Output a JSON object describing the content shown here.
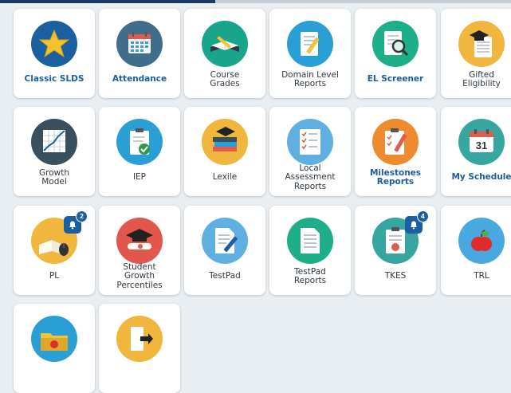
{
  "apps": [
    {
      "label": "Classic SLDS",
      "icon": "star-icon",
      "style": "link",
      "bg": "#1a5fa0"
    },
    {
      "label": "Attendance",
      "icon": "calendar-icon",
      "style": "link",
      "bg": "#3f6d8a"
    },
    {
      "label": "Course\nGrades",
      "icon": "book-pencil-icon",
      "style": "plain",
      "bg": "#18a58c"
    },
    {
      "label": "Domain Level\nReports",
      "icon": "report-pencil-icon",
      "style": "plain",
      "bg": "#2a9fd6"
    },
    {
      "label": "EL Screener",
      "icon": "magnifier-document-icon",
      "style": "link",
      "bg": "#1fae8a"
    },
    {
      "label": "Gifted\nEligibility",
      "icon": "graduation-notebook-icon",
      "style": "plain",
      "bg": "#f0b63e"
    },
    {
      "label": "Growth\nModel",
      "icon": "growth-chart-icon",
      "style": "plain",
      "bg": "#3a4f5e"
    },
    {
      "label": "IEP",
      "icon": "clipboard-check-icon",
      "style": "plain",
      "bg": "#2a9fd6"
    },
    {
      "label": "Lexile",
      "icon": "books-cap-icon",
      "style": "plain",
      "bg": "#f0b63e"
    },
    {
      "label": "Local\nAssessment\nReports",
      "icon": "checklist-icon",
      "style": "plain",
      "bg": "#5fb0e0"
    },
    {
      "label": "Milestones\nReports",
      "icon": "clipboard-pencil-icon",
      "style": "link",
      "bg": "#f08a2e"
    },
    {
      "label": "My Schedule",
      "icon": "calendar-31-icon",
      "style": "link",
      "bg": "#37a6a0",
      "day": "31"
    },
    {
      "label": "PL",
      "icon": "book-mouse-icon",
      "style": "plain",
      "bg": "#f0b63e",
      "badge": "2"
    },
    {
      "label": "Student\nGrowth\nPercentiles",
      "icon": "diploma-cap-icon",
      "style": "plain",
      "bg": "#e2574c"
    },
    {
      "label": "TestPad",
      "icon": "document-pencil-icon",
      "style": "plain",
      "bg": "#5fb0e0"
    },
    {
      "label": "TestPad\nReports",
      "icon": "document-lines-icon",
      "style": "plain",
      "bg": "#1fae8a"
    },
    {
      "label": "TKES",
      "icon": "clipboard-apple-icon",
      "style": "plain",
      "bg": "#37a6a0",
      "badge": "4"
    },
    {
      "label": "TRL",
      "icon": "apple-icon",
      "style": "plain",
      "bg": "#4aa8e0"
    },
    {
      "label": "",
      "icon": "folder-apple-icon",
      "style": "plain",
      "bg": "#2a9fd6"
    },
    {
      "label": "",
      "icon": "exit-door-icon",
      "style": "plain",
      "bg": "#f0b63e"
    }
  ]
}
